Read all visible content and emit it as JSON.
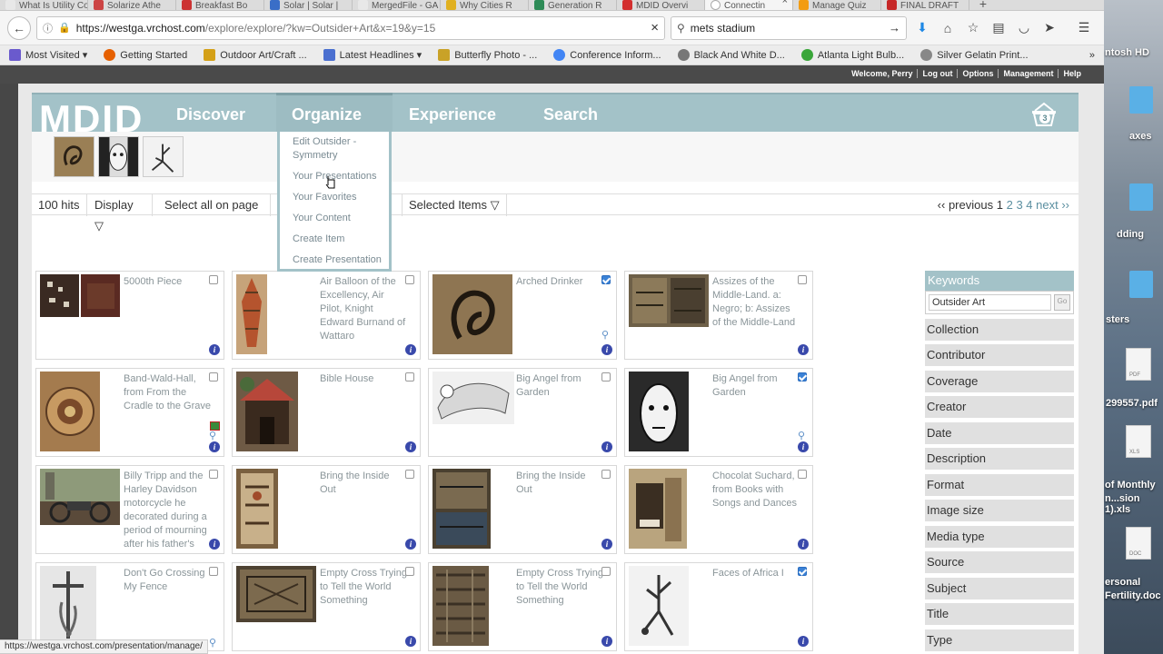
{
  "browser": {
    "tabs": [
      {
        "label": "What Is Utility Co",
        "color": "#e8e8e8"
      },
      {
        "label": "Solarize Athe",
        "color": "#c44"
      },
      {
        "label": "Breakfast Bo",
        "color": "#c33"
      },
      {
        "label": "Solar | Solar |",
        "color": "#3a6ec7"
      },
      {
        "label": "MergedFile - GA",
        "color": "#e8e8e8"
      },
      {
        "label": "Why Cities R",
        "color": "#e0b020"
      },
      {
        "label": "Generation R",
        "color": "#2e8b57"
      },
      {
        "label": "MDID Overvi",
        "color": "#d32f2f"
      },
      {
        "label": "Connectin",
        "color": "#f5f5f5"
      },
      {
        "label": "Manage Quiz",
        "color": "#f39c12"
      },
      {
        "label": "FINAL DRAFT",
        "color": "#c62828"
      }
    ],
    "active_tab_close": "×",
    "new_tab": "+",
    "url_host": "https://westga.vrchost.com",
    "url_rest": "/explore/explore/?kw=Outsider+Art&x=19&y=15",
    "url_clear": "×",
    "search_query": "mets stadium",
    "search_go": "→",
    "bookmarks": [
      {
        "label": "Most Visited ▾",
        "color": "#6a5acd"
      },
      {
        "label": "Getting Started",
        "color": "#e66000"
      },
      {
        "label": "Outdoor Art/Craft ...",
        "color": "#d4a017"
      },
      {
        "label": "Latest Headlines ▾",
        "color": "#4a6fd0"
      },
      {
        "label": "Butterfly Photo - ...",
        "color": "#c9a227"
      },
      {
        "label": "Conference Inform...",
        "color": "#4285f4"
      },
      {
        "label": "Black And White D...",
        "color": "#777"
      },
      {
        "label": "Atlanta Light Bulb...",
        "color": "#3aa63a"
      },
      {
        "label": "Silver Gelatin Print...",
        "color": "#888"
      }
    ],
    "bookmarks_overflow": "»",
    "status_url": "https://westga.vrchost.com/presentation/manage/"
  },
  "desktop": {
    "labels": [
      "ntosh HD",
      "axes",
      "dding",
      "sters",
      "299557.pdf",
      "of Monthly",
      "n...sion 1).xls",
      "ersonal",
      "Fertility.doc"
    ],
    "doc_tags": [
      "PDF",
      "XLS",
      "DOC"
    ]
  },
  "site": {
    "userbar": [
      "Welcome, Perry",
      "Log out",
      "Options",
      "Management",
      "Help"
    ],
    "logo": "MDID",
    "nav": [
      "Discover",
      "Organize",
      "Experience",
      "Search"
    ],
    "basket_count": "3",
    "organize_menu": [
      "Edit Outsider - Symmetry",
      "Your Presentations",
      "Your Favorites",
      "Your Content",
      "Create Item",
      "Create Presentation"
    ],
    "toolbar": {
      "hits": "100 hits",
      "display": "Display ▽",
      "select_all": "Select all on page",
      "selected": "Selected Items ▽"
    },
    "pager": {
      "prev": "‹‹ previous",
      "current": "1",
      "pages": [
        "2",
        "3",
        "4"
      ],
      "next": "next ››"
    },
    "keywords": {
      "heading": "Keywords",
      "value": "Outsider Art",
      "go": "Go"
    },
    "facets": [
      "Collection",
      "Contributor",
      "Coverage",
      "Creator",
      "Date",
      "Description",
      "Format",
      "Image size",
      "Media type",
      "Source",
      "Subject",
      "Title",
      "Type"
    ],
    "records": [
      {
        "title": "5000th Piece",
        "checked": false
      },
      {
        "title": "Air Balloon of the Excellency, Air Pilot, Knight Edward Burnand of Wattaro",
        "checked": false
      },
      {
        "title": "Arched Drinker",
        "checked": true
      },
      {
        "title": "Assizes of the Middle-Land. a: Negro; b: Assizes of the Middle-Land",
        "checked": false
      },
      {
        "title": "Band-Wald-Hall, from From the Cradle to the Grave",
        "checked": false
      },
      {
        "title": "Bible House",
        "checked": false
      },
      {
        "title": "Big Angel from Garden",
        "checked": false
      },
      {
        "title": "Big Angel from Garden",
        "checked": true
      },
      {
        "title": "Billy Tripp and the Harley Davidson motorcycle he decorated during a period of mourning after his father's",
        "checked": false
      },
      {
        "title": "Bring the Inside Out",
        "checked": false
      },
      {
        "title": "Bring the Inside Out",
        "checked": false
      },
      {
        "title": "Chocolat Suchard, from Books with Songs and Dances",
        "checked": false
      },
      {
        "title": "Don't Go Crossing My Fence",
        "checked": false
      },
      {
        "title": "Empty Cross Trying to Tell the World Something",
        "checked": false
      },
      {
        "title": "Empty Cross Trying to Tell the World Something",
        "checked": false
      },
      {
        "title": "Faces of Africa I",
        "checked": true
      }
    ],
    "info_glyph": "i",
    "zoom_glyph": "⚲"
  }
}
